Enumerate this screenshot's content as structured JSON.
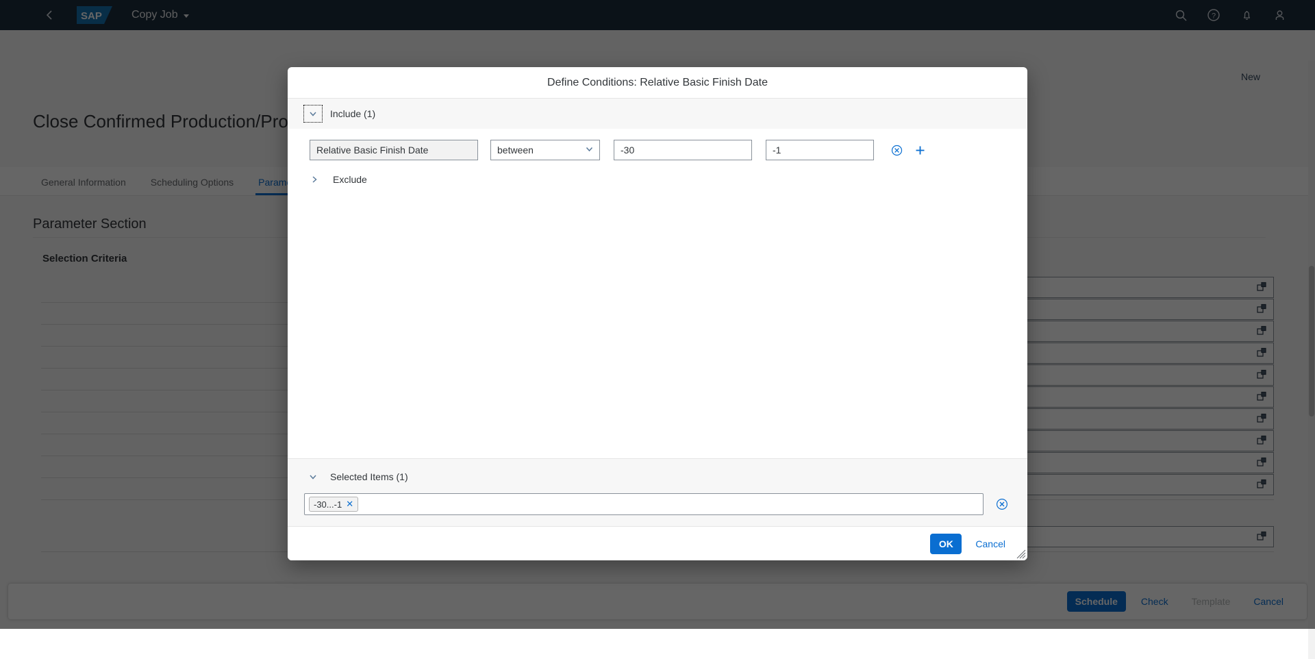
{
  "shell": {
    "back_icon": "back-chevron-icon",
    "logo_text": "SAP",
    "app_title": "Copy Job",
    "icons": [
      {
        "name": "search-icon",
        "label": "Search"
      },
      {
        "name": "help-icon",
        "label": "Help"
      },
      {
        "name": "notifications-bell-icon",
        "label": "Notifications"
      },
      {
        "name": "user-avatar-icon",
        "label": "User"
      }
    ]
  },
  "page": {
    "new_label": "New",
    "title": "Close Confirmed Production/Process O",
    "tabs": [
      {
        "label": "General Information",
        "active": false
      },
      {
        "label": "Scheduling Options",
        "active": false
      },
      {
        "label": "Parameter",
        "active": true
      }
    ],
    "section_title": "Parameter Section",
    "subsection_title": "Selection Criteria",
    "field_rows": 11,
    "value_help_icon": "value-help-icon"
  },
  "page_footer": {
    "schedule_label": "Schedule",
    "check_label": "Check",
    "template_label": "Template",
    "cancel_label": "Cancel"
  },
  "dialog": {
    "title": "Define Conditions: Relative Basic Finish Date",
    "include": {
      "label": "Include (1)",
      "expanded": true,
      "expander_icon": "chevron-down-icon"
    },
    "condition": {
      "field_name": "Relative Basic Finish Date",
      "operator": "between",
      "operator_icon": "chevron-down-icon",
      "value_from": "-30",
      "value_to": "-1",
      "remove_icon": "remove-circle-icon",
      "add_icon": "plus-icon"
    },
    "exclude": {
      "label": "Exclude",
      "expanded": false,
      "expander_icon": "chevron-right-icon"
    },
    "selected_items": {
      "label": "Selected Items (1)",
      "expander_icon": "chevron-down-icon",
      "tokens": [
        {
          "text": "-30...-1",
          "remove_icon": "token-close-icon"
        }
      ],
      "clear_icon": "clear-circle-icon"
    },
    "footer": {
      "ok_label": "OK",
      "cancel_label": "Cancel"
    }
  },
  "colors": {
    "brand_blue": "#0a6ed1",
    "shell_bar": "#1d2d3e",
    "text_default": "#32363a",
    "text_muted": "#6a6d70",
    "border_field": "#89919a"
  }
}
